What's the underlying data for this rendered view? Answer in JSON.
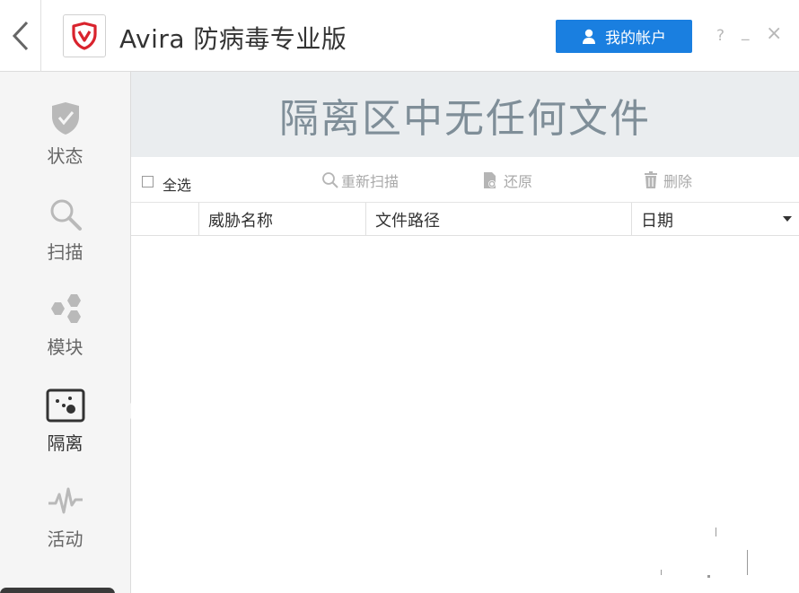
{
  "app": {
    "title": "Avira 防病毒专业版"
  },
  "header": {
    "account_label": "我的帐户",
    "help": "?",
    "minimize": "_",
    "close": "×"
  },
  "sidebar": {
    "items": [
      {
        "label": "状态",
        "icon": "shield-check-icon"
      },
      {
        "label": "扫描",
        "icon": "search-icon"
      },
      {
        "label": "模块",
        "icon": "hexagons-icon"
      },
      {
        "label": "隔离",
        "icon": "quarantine-box-icon",
        "active": true
      },
      {
        "label": "活动",
        "icon": "pulse-icon"
      }
    ]
  },
  "main": {
    "banner": "隔离区中无任何文件",
    "toolbar": {
      "select_all": "全选",
      "rescan": "重新扫描",
      "restore": "还原",
      "delete": "删除"
    },
    "table": {
      "columns": [
        "威胁名称",
        "文件路径",
        "日期"
      ],
      "rows": []
    }
  },
  "colors": {
    "accent": "#1a7fe0",
    "brand_red": "#d9232d",
    "banner_bg": "#eaedef",
    "banner_text": "#7f8e98"
  }
}
